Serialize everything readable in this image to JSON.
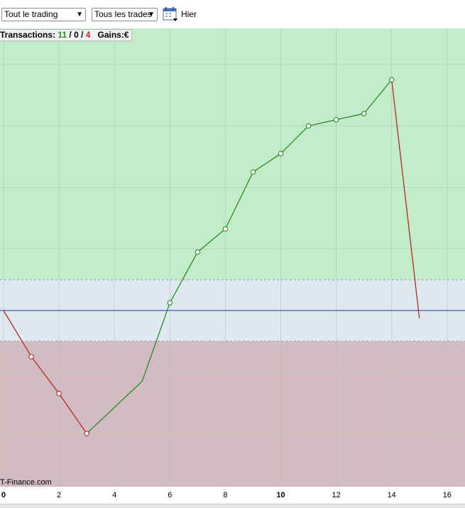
{
  "toolbar": {
    "period_select": "Tout le trading",
    "trades_select": "Tous les trades",
    "date_label": "Hier"
  },
  "stats": {
    "transactions_label": "Transactions:",
    "wins": "11",
    "sep1": " / ",
    "even": "0",
    "sep2": " / ",
    "losses": "4",
    "gains_label": "Gains:",
    "currency": "€"
  },
  "watermark": "T-Finance.com",
  "colors": {
    "profit_zone": "#c3ecc8",
    "neutral_zone": "#dde9ee",
    "loss_zone": "#d3bcc1",
    "rise_line": "#2a8a2a",
    "fall_line": "#b42828",
    "baseline": "#2a2ac8"
  },
  "chart_data": {
    "type": "line",
    "title": "",
    "xlabel": "",
    "ylabel": "",
    "xlim": [
      0,
      16.6
    ],
    "ylim": [
      -13.2,
      19.4
    ],
    "x_ticks": [
      0,
      2,
      4,
      6,
      8,
      10,
      12,
      14,
      16
    ],
    "x_tick_labels": [
      "0",
      "2",
      "4",
      "6",
      "8",
      "10",
      "12",
      "14",
      "16"
    ],
    "grid": true,
    "baseline": 0,
    "neutral_band": [
      -2,
      2
    ],
    "x": [
      0,
      1,
      2,
      3,
      4,
      5,
      6,
      7,
      8,
      9,
      10,
      11,
      12,
      13,
      14,
      15
    ],
    "y": [
      0,
      -3,
      -5.4,
      -8,
      -6.3,
      -4.6,
      0.5,
      3.8,
      5.3,
      9,
      10.2,
      12,
      12.4,
      12.8,
      15,
      -0.5
    ],
    "markers": [
      false,
      true,
      true,
      true,
      false,
      false,
      true,
      true,
      true,
      true,
      true,
      true,
      true,
      true,
      true,
      false
    ]
  }
}
